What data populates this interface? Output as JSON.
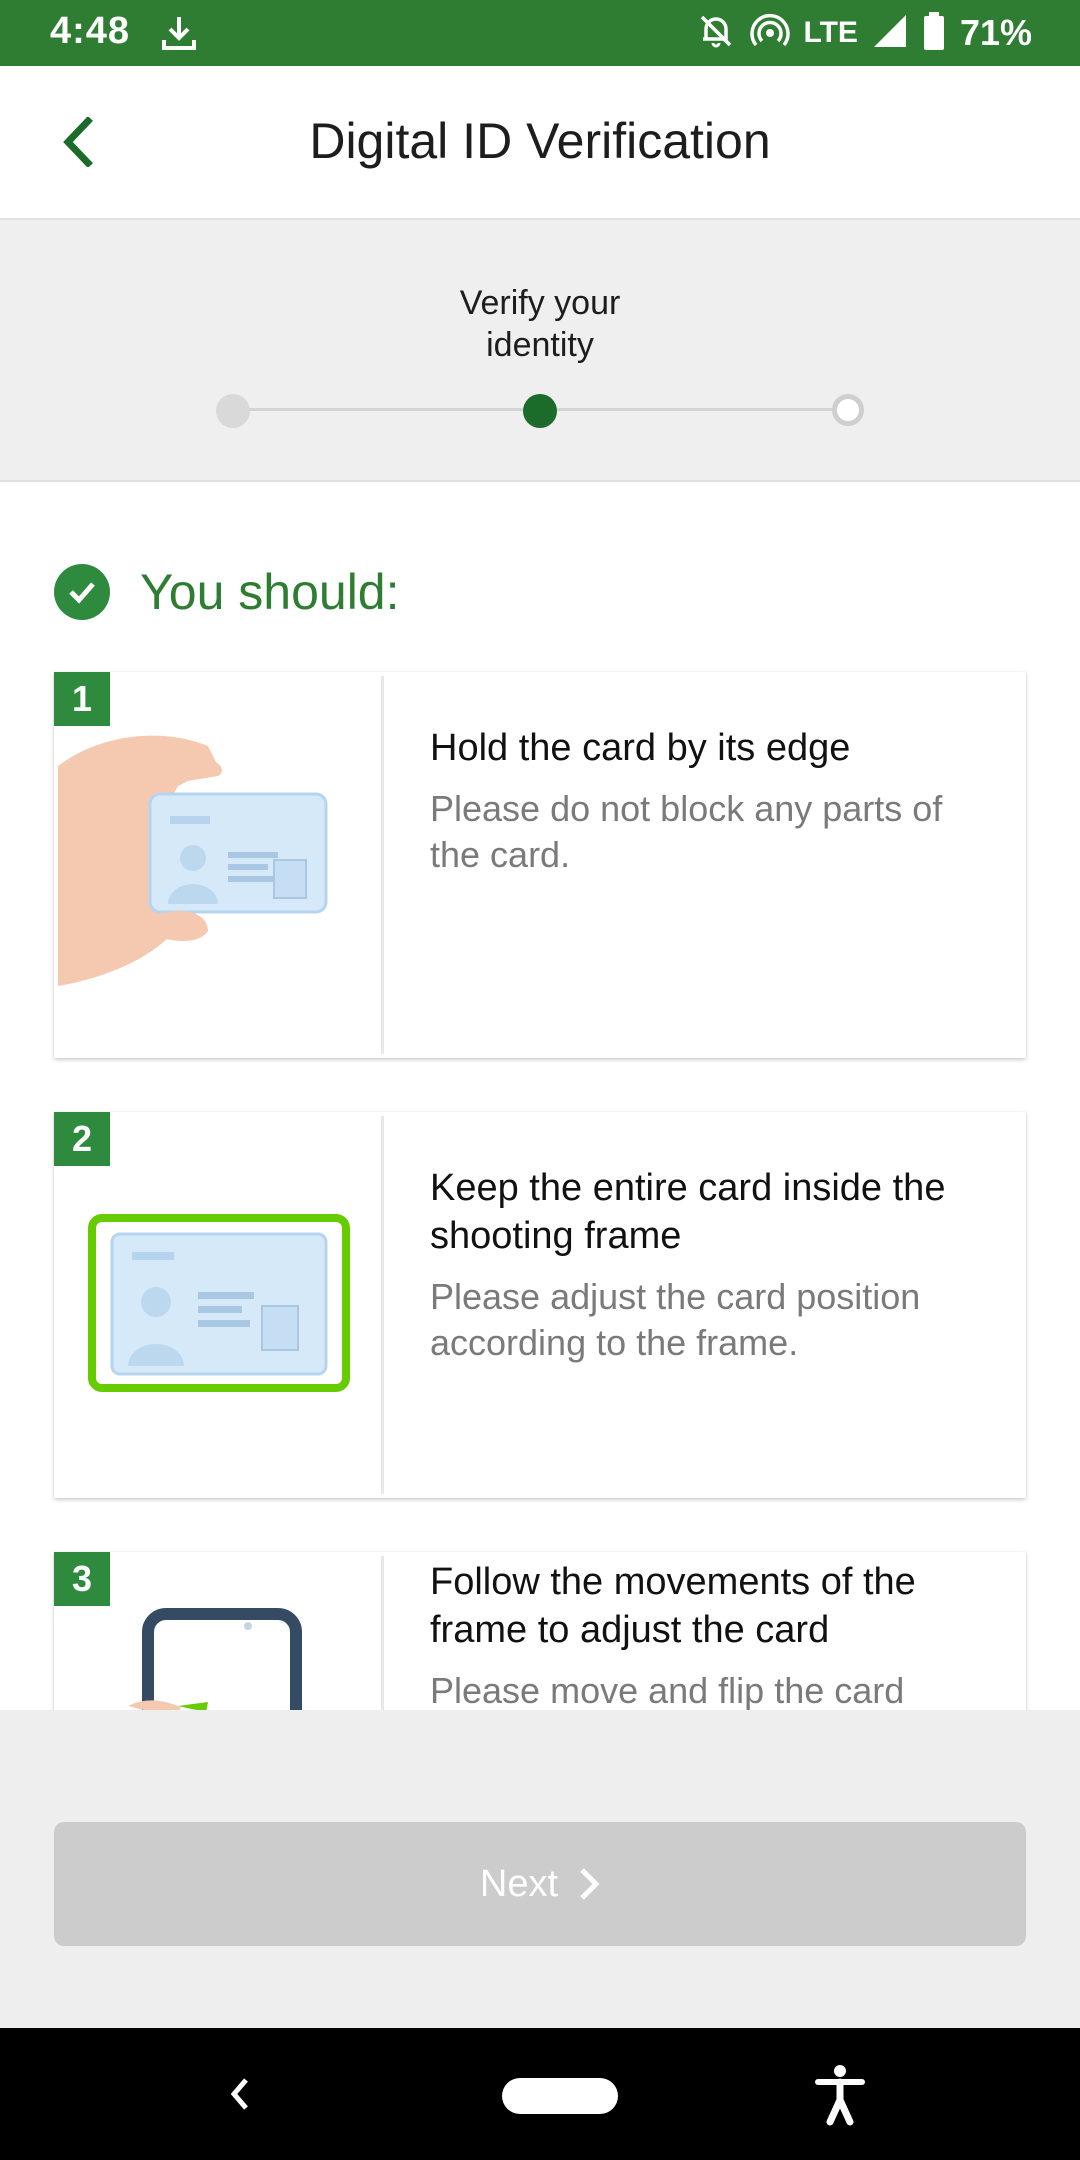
{
  "status_bar": {
    "time": "4:48",
    "network": "LTE",
    "battery": "71%",
    "icons": [
      "download-icon",
      "bell-off-icon",
      "hotspot-icon",
      "signal-icon",
      "battery-icon"
    ]
  },
  "app_bar": {
    "title": "Digital ID Verification",
    "back_icon": "chevron-left-icon"
  },
  "stepper": {
    "current_step_label": "Verify your identity",
    "steps_total": 3,
    "current_step": 2
  },
  "section": {
    "heading": "You should:"
  },
  "instructions": [
    {
      "number": "1",
      "title": "Hold the card by its edge",
      "description": "Please do not block any parts of the card."
    },
    {
      "number": "2",
      "title": "Keep the entire card inside the shooting frame",
      "description": "Please adjust the card position according to the frame."
    },
    {
      "number": "3",
      "title": "Follow the movements of the frame to adjust the card",
      "description": "Please move and flip the card"
    }
  ],
  "footer": {
    "next_label": "Next"
  },
  "colors": {
    "primary": "#2e7d32",
    "badge": "#2e8b3e",
    "frame_green": "#66cc00",
    "disabled_button": "#cccccc"
  }
}
